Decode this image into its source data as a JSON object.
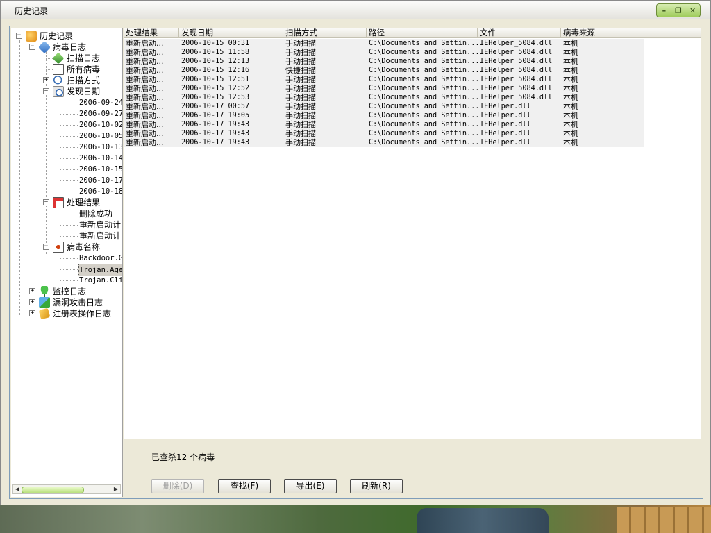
{
  "window": {
    "title": "历史记录"
  },
  "tree": {
    "root": "历史记录",
    "virus_log": "病毒日志",
    "scan_log": "扫描日志",
    "all_viruses": "所有病毒",
    "scan_method": "扫描方式",
    "found_date": "发现日期",
    "dates": [
      "2006-09-24",
      "2006-09-27",
      "2006-10-02",
      "2006-10-05",
      "2006-10-13",
      "2006-10-14",
      "2006-10-15",
      "2006-10-17",
      "2006-10-18"
    ],
    "process_result": "处理结果",
    "results": [
      "删除成功",
      "重新启动计",
      "重新启动计"
    ],
    "virus_name": "病毒名称",
    "virus_names": [
      "Backdoor.G",
      "Trojan.Age",
      "Trojan.Cli"
    ],
    "monitor_log": "监控日志",
    "exploit_log": "漏洞攻击日志",
    "registry_log": "注册表操作日志"
  },
  "table": {
    "columns": [
      "处理结果",
      "发现日期",
      "扫描方式",
      "路径",
      "文件",
      "病毒来源"
    ],
    "rows": [
      [
        "重新启动...",
        "2006-10-15 00:31",
        "手动扫描",
        "C:\\Documents and Settin...",
        "IEHelper_5084.dll",
        "本机"
      ],
      [
        "重新启动...",
        "2006-10-15 11:58",
        "手动扫描",
        "C:\\Documents and Settin...",
        "IEHelper_5084.dll",
        "本机"
      ],
      [
        "重新启动...",
        "2006-10-15 12:13",
        "手动扫描",
        "C:\\Documents and Settin...",
        "IEHelper_5084.dll",
        "本机"
      ],
      [
        "重新启动...",
        "2006-10-15 12:16",
        "快捷扫描",
        "C:\\Documents and Settin...",
        "IEHelper_5084.dll",
        "本机"
      ],
      [
        "重新启动...",
        "2006-10-15 12:51",
        "手动扫描",
        "C:\\Documents and Settin...",
        "IEHelper_5084.dll",
        "本机"
      ],
      [
        "重新启动...",
        "2006-10-15 12:52",
        "手动扫描",
        "C:\\Documents and Settin...",
        "IEHelper_5084.dll",
        "本机"
      ],
      [
        "重新启动...",
        "2006-10-15 12:53",
        "手动扫描",
        "C:\\Documents and Settin...",
        "IEHelper_5084.dll",
        "本机"
      ],
      [
        "重新启动...",
        "2006-10-17 00:57",
        "手动扫描",
        "C:\\Documents and Settin...",
        "IEHelper.dll",
        "本机"
      ],
      [
        "重新启动...",
        "2006-10-17 19:05",
        "手动扫描",
        "C:\\Documents and Settin...",
        "IEHelper.dll",
        "本机"
      ],
      [
        "重新启动...",
        "2006-10-17 19:43",
        "手动扫描",
        "C:\\Documents and Settin...",
        "IEHelper.dll",
        "本机"
      ],
      [
        "重新启动...",
        "2006-10-17 19:43",
        "手动扫描",
        "C:\\Documents and Settin...",
        "IEHelper.dll",
        "本机"
      ],
      [
        "重新启动...",
        "2006-10-17 19:43",
        "手动扫描",
        "C:\\Documents and Settin...",
        "IEHelper.dll",
        "本机"
      ]
    ]
  },
  "status": {
    "text": "已查杀12 个病毒"
  },
  "buttons": {
    "delete": "删除(D)",
    "find": "查找(F)",
    "export": "导出(E)",
    "refresh": "刷新(R)"
  },
  "controls": {
    "minimize": "–",
    "restore": "❐",
    "close": "✕"
  }
}
